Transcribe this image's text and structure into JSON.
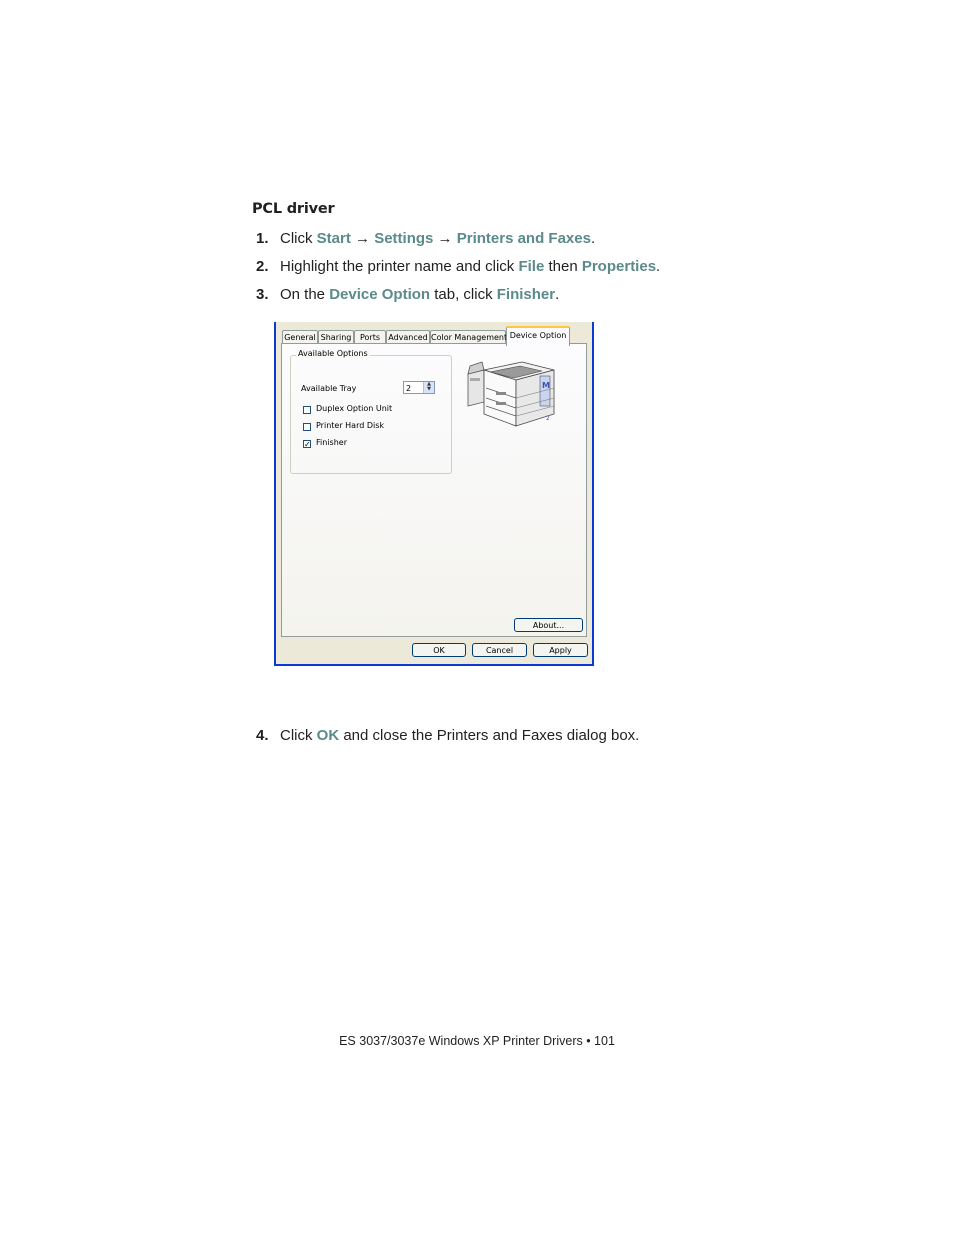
{
  "heading": "PCL driver",
  "steps": [
    {
      "num": "1.",
      "t1": "Click ",
      "h1": "Start",
      "t2": " → ",
      "h2": "Settings",
      "t3": " → ",
      "h3": "Printers and Faxes",
      "t4": "."
    },
    {
      "num": "2.",
      "t1": "Highlight the printer name and click ",
      "h1": "File",
      "t2": " then ",
      "h2": "Properties",
      "t3": "."
    },
    {
      "num": "3.",
      "t1": "On the ",
      "h1": "Device Option",
      "t2": " tab, click ",
      "h2": "Finisher",
      "t3": "."
    },
    {
      "num": "4.",
      "t1": "Click ",
      "h1": "OK",
      "t2": " and close the Printers and Faxes dialog box."
    }
  ],
  "dialog": {
    "tabs": [
      "General",
      "Sharing",
      "Ports",
      "Advanced",
      "Color Management",
      "Device Option"
    ],
    "group_title": "Available Options",
    "available_tray_label": "Available Tray",
    "available_tray_value": "2",
    "checkboxes": [
      {
        "label": "Duplex Option Unit",
        "checked": false
      },
      {
        "label": "Printer Hard Disk",
        "checked": false
      },
      {
        "label": "Finisher",
        "checked": true
      }
    ],
    "check_mark": "✓",
    "about_button": "About...",
    "ok_button": "OK",
    "cancel_button": "Cancel",
    "apply_button": "Apply"
  },
  "footer": "ES 3037/3037e Windows XP Printer Drivers • 101"
}
